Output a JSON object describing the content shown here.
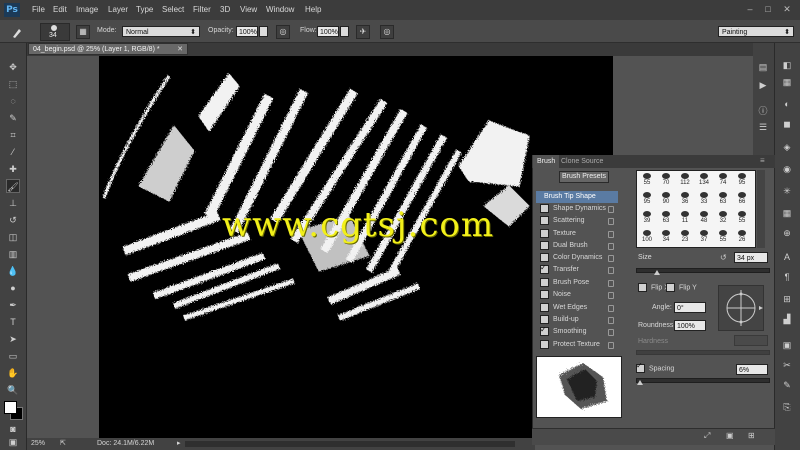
{
  "app": {
    "logo": "Ps"
  },
  "menu": [
    "File",
    "Edit",
    "Image",
    "Layer",
    "Type",
    "Select",
    "Filter",
    "3D",
    "View",
    "Window",
    "Help"
  ],
  "window_controls": {
    "minimize": "–",
    "maximize": "□",
    "close": "✕"
  },
  "options": {
    "brush_size": "34",
    "mode_label": "Mode:",
    "mode_value": "Normal",
    "opacity_label": "Opacity:",
    "opacity_value": "100%",
    "flow_label": "Flow:",
    "flow_value": "100%",
    "workspace": "Painting"
  },
  "document": {
    "tab_title": "04_begin.psd @ 25% (Layer 1, RGB/8) *"
  },
  "status": {
    "zoom": "25%",
    "doc": "Doc: 24.1M/6.22M"
  },
  "brush_panel": {
    "tabs": [
      "Brush",
      "Clone Source"
    ],
    "presets_button": "Brush Presets",
    "options": [
      {
        "label": "Brush Tip Shape",
        "checked": null,
        "selected": true
      },
      {
        "label": "Shape Dynamics",
        "checked": false
      },
      {
        "label": "Scattering",
        "checked": false
      },
      {
        "label": "Texture",
        "checked": false
      },
      {
        "label": "Dual Brush",
        "checked": false
      },
      {
        "label": "Color Dynamics",
        "checked": false
      },
      {
        "label": "Transfer",
        "checked": true
      },
      {
        "label": "Brush Pose",
        "checked": false
      },
      {
        "label": "Noise",
        "checked": false
      },
      {
        "label": "Wet Edges",
        "checked": false
      },
      {
        "label": "Build-up",
        "checked": false
      },
      {
        "label": "Smoothing",
        "checked": true
      },
      {
        "label": "Protect Texture",
        "checked": false
      }
    ],
    "tip_sizes": [
      "55",
      "70",
      "112",
      "134",
      "74",
      "95",
      "95",
      "90",
      "36",
      "33",
      "63",
      "66",
      "39",
      "63",
      "11",
      "48",
      "32",
      "55",
      "100",
      "34",
      "23",
      "37",
      "55",
      "26"
    ],
    "size_label": "Size",
    "size_value": "34 px",
    "flip_x": "Flip X",
    "flip_y": "Flip Y",
    "angle_label": "Angle:",
    "angle_value": "0°",
    "roundness_label": "Roundness:",
    "roundness_value": "100%",
    "hardness_label": "Hardness",
    "spacing_label": "Spacing",
    "spacing_value": "6%"
  },
  "watermark": "www.cgtsj.com",
  "colors": {
    "accent": "#5a7ba3",
    "watermark": "#f2f01a",
    "canvas": "#000000"
  }
}
